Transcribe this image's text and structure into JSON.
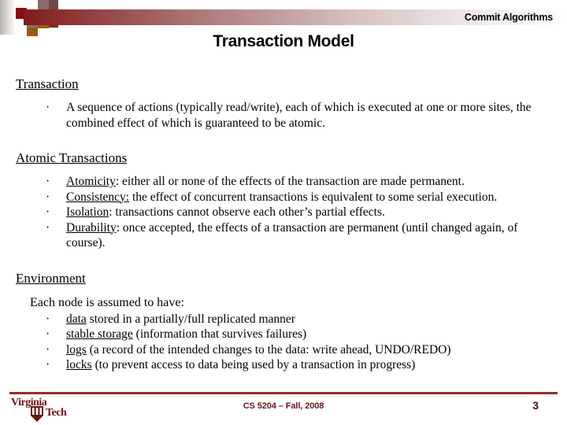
{
  "header": {
    "subtitle": "Commit Algorithms",
    "title": "Transaction Model",
    "gradient_start": "#7e1d1d",
    "gradient_end": "#ffffff"
  },
  "sections": [
    {
      "heading": "Transaction",
      "bullets": [
        {
          "term": "",
          "text": "A sequence of actions (typically read/write), each of which is executed at one or more sites, the combined effect of which is guaranteed to be atomic."
        }
      ]
    },
    {
      "heading": "Atomic Transactions",
      "bullets": [
        {
          "term": "Atomicity",
          "text": ": either all or none of the effects of the transaction are made permanent."
        },
        {
          "term": "Consistency:",
          "text": " the effect of concurrent transactions is equivalent to some serial execution."
        },
        {
          "term": "Isolation",
          "text": ": transactions cannot observe each other’s partial effects."
        },
        {
          "term": "Durability",
          "text": ": once accepted, the effects of a transaction are permanent (until changed again, of course)."
        }
      ]
    },
    {
      "heading": "Environment",
      "lead": "Each node is assumed to have:",
      "bullets": [
        {
          "term": "data",
          "text": " stored in a partially/full replicated manner"
        },
        {
          "term": "stable storage",
          "text": " (information that survives failures)"
        },
        {
          "term": "logs",
          "text": " (a record of the intended changes to the data: write ahead, UNDO/REDO)"
        },
        {
          "term": "locks",
          "text": " (to prevent access to data being used by a transaction in progress)"
        }
      ]
    }
  ],
  "bullet_glyph": "·",
  "footer": {
    "logo_line1": "Virginia",
    "logo_line2": "Tech",
    "center_text": "CS 5204 – Fall, 2008",
    "page_number": "3",
    "rule_color": "#93301d",
    "text_color": "#6b1414"
  }
}
